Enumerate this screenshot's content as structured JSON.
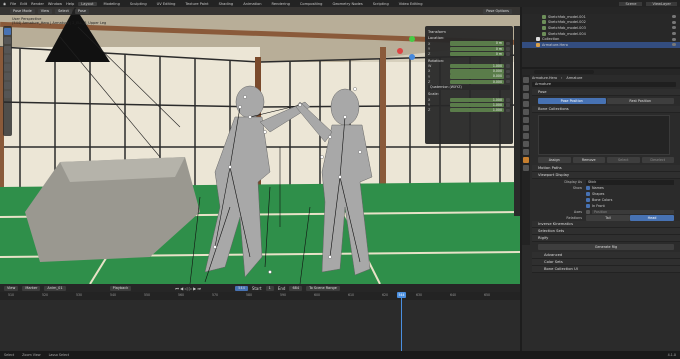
{
  "topbar": {
    "menus": [
      "File",
      "Edit",
      "Render",
      "Window",
      "Help"
    ],
    "workspaces": [
      "Layout",
      "Modeling",
      "Sculpting",
      "UV Editing",
      "Texture Paint",
      "Shading",
      "Animation",
      "Rendering",
      "Compositing",
      "Geometry Nodes",
      "Scripting",
      "Video Editing"
    ],
    "active_workspace": "Layout",
    "scene": "Scene",
    "view_layer": "ViewLayer"
  },
  "viewport": {
    "mode": "Pose Mode",
    "menus": [
      "View",
      "Select",
      "Pose"
    ],
    "overlay_line1": "User Perspective",
    "overlay_line2": "(544) Armature_Hero | Armature | 2_ELL_R_Upper Leg",
    "pose_options": "Pose Options"
  },
  "npanel": {
    "title": "Transform",
    "location_label": "Location:",
    "location": [
      {
        "axis": "X",
        "value": "0 m"
      },
      {
        "axis": "Y",
        "value": "0 m"
      },
      {
        "axis": "Z",
        "value": "0 m"
      }
    ],
    "rotation_label": "Rotation:",
    "rotation": [
      {
        "axis": "W",
        "value": "1.000"
      },
      {
        "axis": "X",
        "value": "0.000"
      },
      {
        "axis": "Y",
        "value": "0.000"
      },
      {
        "axis": "Z",
        "value": "0.000"
      }
    ],
    "rotation_mode": "Quaternion (WXYZ)",
    "scale_label": "Scale:",
    "scale": [
      {
        "axis": "X",
        "value": "1.000"
      },
      {
        "axis": "Y",
        "value": "1.000"
      },
      {
        "axis": "Z",
        "value": "1.000"
      }
    ]
  },
  "timeline": {
    "menus": [
      "View",
      "Marker"
    ],
    "action": "Anim_01",
    "playback": "Playback",
    "current_frame": "544",
    "start_label": "Start",
    "start": "1",
    "end_label": "End",
    "end": "684",
    "scene_range": "To Scene Range",
    "ticks": [
      "510",
      "520",
      "530",
      "540",
      "550",
      "560",
      "570",
      "580",
      "590",
      "600",
      "610",
      "620",
      "630",
      "640",
      "650"
    ],
    "playhead_label": "544"
  },
  "status": [
    "Select",
    "Zoom View",
    "Lasso Select"
  ],
  "outliner": {
    "items": [
      "Sketchfab_model.001",
      "Sketchfab_model.002",
      "Sketchfab_model.003",
      "Sketchfab_model.004",
      "Collection",
      "Armature.Hero"
    ]
  },
  "props": {
    "search_placeholder": "",
    "breadcrumb": [
      "Armature.Hero",
      "Armature"
    ],
    "datablock": "Armature",
    "pose": "Pose",
    "pose_position": "Pose Position",
    "rest_position": "Rest Position",
    "bone_collections": "Bone Collections",
    "assign": "Assign",
    "remove": "Remove",
    "select": "Select",
    "deselect": "Deselect",
    "motion_paths": "Motion Paths",
    "viewport_display": "Viewport Display",
    "display_as_label": "Display As",
    "display_as": "Stick",
    "show_label": "Show",
    "show_options": [
      "Names",
      "Shapes",
      "Bone Colors",
      "In Front"
    ],
    "axes_label": "Axes",
    "axes_value": "Position",
    "relations_label": "Relations",
    "tail": "Tail",
    "head": "Head",
    "inverse_kinematics": "Inverse Kinematics",
    "selection_sets": "Selection Sets",
    "rigify": "Rigify",
    "generate_rig": "Generate Rig",
    "advanced": "Advanced",
    "color_sets": "Color Sets",
    "bone_collection_ui": "Bone Collection UI"
  },
  "version": "4.1.0",
  "colors": {
    "accent": "#4772b3",
    "field_green": "#5a7c4a",
    "tatami": "#2f8f4a"
  }
}
